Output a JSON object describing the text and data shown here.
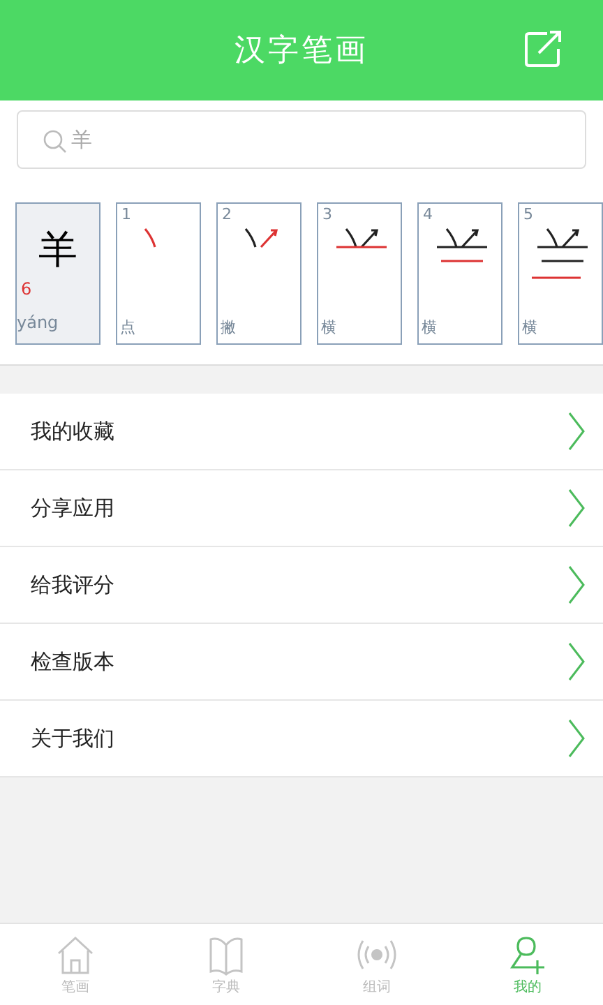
{
  "header": {
    "title": "汉字笔画"
  },
  "search": {
    "placeholder": "羊"
  },
  "character": {
    "glyph": "羊",
    "stroke_count": "6",
    "pinyin": "yáng"
  },
  "strokes": [
    {
      "number": "1",
      "name": "点"
    },
    {
      "number": "2",
      "name": "撇"
    },
    {
      "number": "3",
      "name": "横"
    },
    {
      "number": "4",
      "name": "横"
    },
    {
      "number": "5",
      "name": "横"
    }
  ],
  "menu": [
    {
      "label": "我的收藏"
    },
    {
      "label": "分享应用"
    },
    {
      "label": "给我评分"
    },
    {
      "label": "检查版本"
    },
    {
      "label": "关于我们"
    }
  ],
  "tabs": [
    {
      "kind": "home",
      "label": "笔画",
      "selected": false
    },
    {
      "kind": "book",
      "label": "字典",
      "selected": false
    },
    {
      "kind": "radio",
      "label": "组词",
      "selected": false
    },
    {
      "kind": "user",
      "label": "我的",
      "selected": true
    }
  ]
}
